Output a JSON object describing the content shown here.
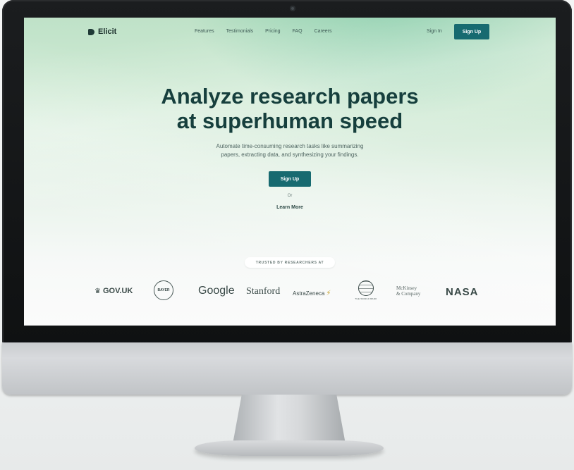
{
  "nav": {
    "logo": "Elicit",
    "links": [
      "Features",
      "Testimonials",
      "Pricing",
      "FAQ",
      "Careers"
    ],
    "sign_in": "Sign In",
    "sign_up": "Sign Up"
  },
  "hero": {
    "title_line1": "Analyze research papers",
    "title_line2": "at superhuman speed",
    "subtitle_line1": "Automate time-consuming research tasks like summarizing",
    "subtitle_line2": "papers, extracting data, and synthesizing your findings.",
    "cta": "Sign Up",
    "or": "Or",
    "learn_more": "Learn More"
  },
  "trusted": {
    "label": "TRUSTED BY RESEARCHERS AT",
    "logos": {
      "gov": "GOV.UK",
      "bayer": "BAYER",
      "google": "Google",
      "stanford": "Stanford",
      "astrazeneca": "AstraZeneca",
      "worldbank": "THE WORLD BANK",
      "mckinsey_line1": "McKinsey",
      "mckinsey_line2": "& Company",
      "nasa": "NASA"
    }
  },
  "colors": {
    "accent": "#176a70",
    "title": "#163f3d",
    "bezel": "#111315"
  },
  "icons": [
    "camera-icon",
    "elicit-logo-icon",
    "crown-icon",
    "globe-icon",
    "astrazeneca-mark-icon"
  ]
}
